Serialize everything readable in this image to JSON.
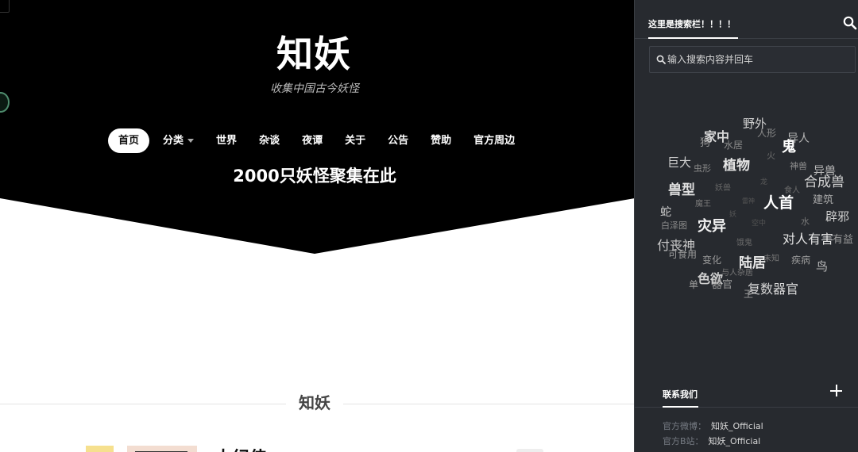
{
  "site": {
    "title": "知妖",
    "subtitle": "收集中国古今妖怪",
    "tagline": "2000只妖怪聚集在此"
  },
  "nav": {
    "items": [
      {
        "label": "首页",
        "active": true
      },
      {
        "label": "分类",
        "dropdown": true
      },
      {
        "label": "世界"
      },
      {
        "label": "杂谈"
      },
      {
        "label": "夜谭"
      },
      {
        "label": "关于"
      },
      {
        "label": "公告"
      },
      {
        "label": "赞助"
      },
      {
        "label": "官方周边"
      }
    ]
  },
  "section": {
    "title": "知妖",
    "first_entry_title": "大纪侍"
  },
  "sidebar": {
    "search_tab_label": "这里是搜索栏！！！！",
    "search_placeholder": "输入搜索内容并回车",
    "tags": [
      {
        "text": "野外",
        "color": "#cfcfcf"
      },
      {
        "text": "人形",
        "color": "#8a8a8a"
      },
      {
        "text": "异人",
        "color": "#b5b5b5"
      },
      {
        "text": "家中",
        "color": "#d8d8d8"
      },
      {
        "text": "狗",
        "color": "#9a9a9a"
      },
      {
        "text": "水居",
        "color": "#8a8a8a"
      },
      {
        "text": "鬼",
        "color": "#ffffff"
      },
      {
        "text": "火",
        "color": "#6a6a6a"
      },
      {
        "text": "巨大",
        "color": "#d0d0d0"
      },
      {
        "text": "虫形",
        "color": "#8a8a8a"
      },
      {
        "text": "植物",
        "color": "#e6e6e6"
      },
      {
        "text": "神兽",
        "color": "#8e8e8e"
      },
      {
        "text": "异兽",
        "color": "#b8b8b8"
      },
      {
        "text": "合成兽",
        "color": "#d6d6d6"
      },
      {
        "text": "兽型",
        "color": "#e0e0e0"
      },
      {
        "text": "妖兽",
        "color": "#666666"
      },
      {
        "text": "龙",
        "color": "#5a5a5a"
      },
      {
        "text": "食人",
        "color": "#6a6a6a"
      },
      {
        "text": "建筑",
        "color": "#a8a8a8"
      },
      {
        "text": "魔王",
        "color": "#777777"
      },
      {
        "text": "雷神",
        "color": "#555555"
      },
      {
        "text": "人首",
        "color": "#ffffff"
      },
      {
        "text": "蛇",
        "color": "#cfcfcf"
      },
      {
        "text": "妖",
        "color": "#555555"
      },
      {
        "text": "水",
        "color": "#777777"
      },
      {
        "text": "辟邪",
        "color": "#cfcfcf"
      },
      {
        "text": "白泽图",
        "color": "#8a8a8a"
      },
      {
        "text": "灾异",
        "color": "#f2f2f2"
      },
      {
        "text": "空中",
        "color": "#555555"
      },
      {
        "text": "对人有害",
        "color": "#e6e6e6"
      },
      {
        "text": "有益",
        "color": "#9a9a9a"
      },
      {
        "text": "付丧神",
        "color": "#c8c8c8"
      },
      {
        "text": "饿鬼",
        "color": "#6a6a6a"
      },
      {
        "text": "可食用",
        "color": "#9a9a9a"
      },
      {
        "text": "未知",
        "color": "#777777"
      },
      {
        "text": "变化",
        "color": "#9a9a9a"
      },
      {
        "text": "陆居",
        "color": "#e8e8e8"
      },
      {
        "text": "疾病",
        "color": "#9a9a9a"
      },
      {
        "text": "鸟",
        "color": "#b8b8b8"
      },
      {
        "text": "与人杂居",
        "color": "#777777"
      },
      {
        "text": "色欲",
        "color": "#d0d0d0"
      },
      {
        "text": "单",
        "color": "#9a9a9a"
      },
      {
        "text": "器官",
        "color": "#9a9a9a"
      },
      {
        "text": "复数器官",
        "color": "#d8d8d8"
      },
      {
        "text": "王",
        "color": "#9a9a9a"
      }
    ],
    "contact": {
      "title": "联系我们",
      "rows": [
        {
          "label": "官方微博：",
          "value": "知妖_Official"
        },
        {
          "label": "官方B站：",
          "value": "知妖_Official"
        }
      ]
    }
  },
  "colors": {
    "hero_bg": "#000000",
    "sidebar_bg": "#272a2f",
    "active_nav_bg": "#ffffff"
  }
}
